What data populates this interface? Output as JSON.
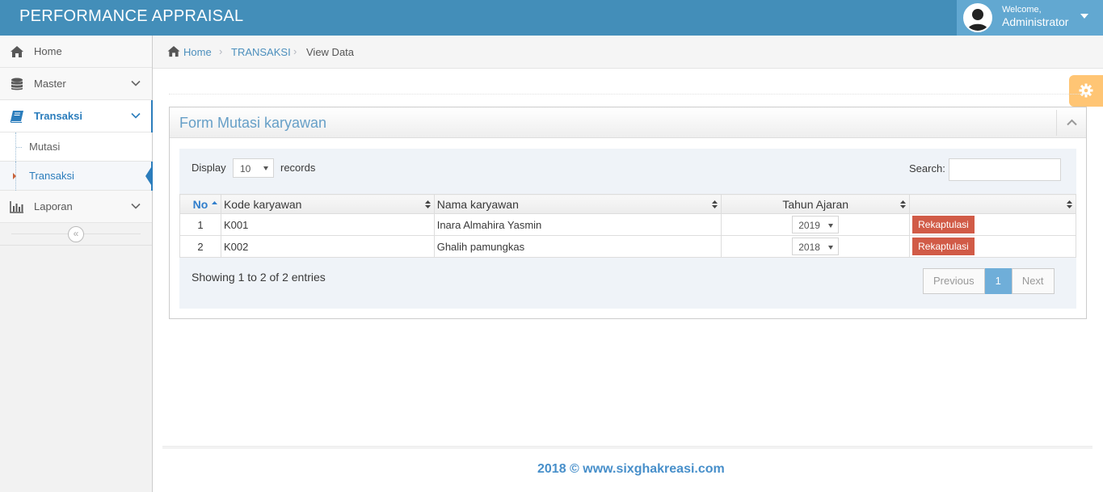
{
  "header": {
    "brand": "PERFORMANCE APPRAISAL",
    "welcome": "Welcome,",
    "user_name": "Administrator"
  },
  "sidebar": {
    "items": [
      {
        "label": "Home",
        "icon": "home-icon"
      },
      {
        "label": "Master",
        "icon": "database-icon"
      },
      {
        "label": "Transaksi",
        "icon": "book-icon"
      },
      {
        "label": "Laporan",
        "icon": "bar-chart-icon"
      }
    ],
    "sub_items": [
      {
        "label": "Mutasi"
      },
      {
        "label": "Transaksi"
      }
    ],
    "collapse_glyph": "«"
  },
  "breadcrumb": {
    "home": "Home",
    "section": "TRANSAKSI",
    "current": "View Data"
  },
  "widget": {
    "title": "Form Mutasi karyawan"
  },
  "table_controls": {
    "display_label": "Display",
    "display_value": "10",
    "records_label": "records",
    "search_label": "Search:"
  },
  "table": {
    "headers": [
      "No",
      "Kode karyawan",
      "Nama karyawan",
      "Tahun Ajaran",
      ""
    ],
    "rows": [
      {
        "no": "1",
        "kode": "K001",
        "nama": "Inara Almahira Yasmin",
        "tahun": "2019",
        "action": "Rekaptulasi"
      },
      {
        "no": "2",
        "kode": "K002",
        "nama": "Ghalih pamungkas",
        "tahun": "2018",
        "action": "Rekaptulasi"
      }
    ]
  },
  "pagination": {
    "info": "Showing 1 to 2 of 2 entries",
    "previous": "Previous",
    "page": "1",
    "next": "Next"
  },
  "footer": {
    "text": "2018 © www.sixghakreasi.com"
  },
  "colors": {
    "navbar": "#438eb9",
    "accent": "#2b7dbc",
    "action_button": "#d15b47",
    "settings_button": "#ffb752"
  }
}
